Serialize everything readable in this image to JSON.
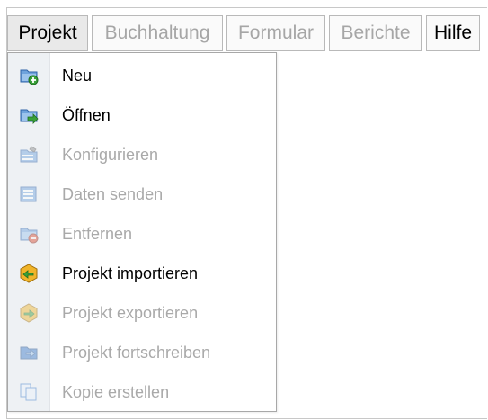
{
  "menubar": {
    "items": [
      {
        "label": "Projekt",
        "state": "active"
      },
      {
        "label": "Buchhaltung",
        "state": "disabled"
      },
      {
        "label": "Formular",
        "state": "disabled"
      },
      {
        "label": "Berichte",
        "state": "disabled"
      },
      {
        "label": "Hilfe",
        "state": "enabled"
      }
    ]
  },
  "dropdown": {
    "items": [
      {
        "label": "Neu",
        "enabled": true,
        "icon": "folder-new-icon"
      },
      {
        "label": "Öffnen",
        "enabled": true,
        "icon": "folder-open-icon"
      },
      {
        "label": "Konfigurieren",
        "enabled": false,
        "icon": "configure-icon"
      },
      {
        "label": "Daten senden",
        "enabled": false,
        "icon": "send-data-icon"
      },
      {
        "label": "Entfernen",
        "enabled": false,
        "icon": "folder-remove-icon"
      },
      {
        "label": "Projekt importieren",
        "enabled": true,
        "icon": "import-icon"
      },
      {
        "label": "Projekt exportieren",
        "enabled": false,
        "icon": "export-icon"
      },
      {
        "label": "Projekt fortschreiben",
        "enabled": false,
        "icon": "folder-forward-icon"
      },
      {
        "label": "Kopie erstellen",
        "enabled": false,
        "icon": "copy-icon"
      }
    ]
  },
  "colors": {
    "enabled_text": "#000000",
    "disabled_text": "#a9a9a9",
    "icon_column": "#eef1f4",
    "folder_blue": "#3a78c9",
    "accent_green": "#3aa13a",
    "accent_red": "#d9452b",
    "accent_yellow": "#f0b429"
  }
}
